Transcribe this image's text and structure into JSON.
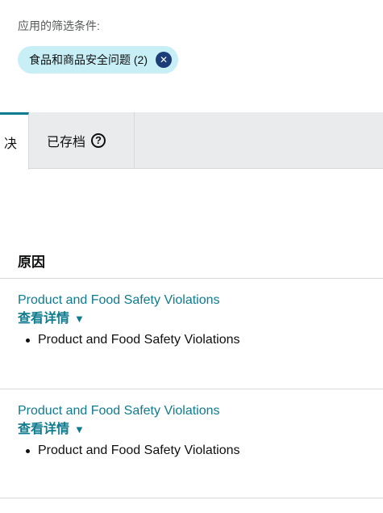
{
  "filters": {
    "label": "应用的筛选条件:",
    "chip": {
      "label": "食品和商品安全问题 (2)",
      "icon": "close-circle-icon"
    }
  },
  "tabs": {
    "active_label": "决",
    "archived_label": "已存档",
    "help_icon": "question-circle-icon",
    "help_glyph": "?"
  },
  "section": {
    "title": "原因"
  },
  "rows": [
    {
      "reason": "Product and Food Safety Violations",
      "details_label": "查看详情",
      "bullet": "Product and Food Safety Violations"
    },
    {
      "reason": "Product and Food Safety Violations",
      "details_label": "查看详情",
      "bullet": "Product and Food Safety Violations"
    }
  ],
  "colors": {
    "link": "#0f7b8e",
    "chip_bg": "#c8eef6",
    "chip_close": "#1c3d78"
  }
}
